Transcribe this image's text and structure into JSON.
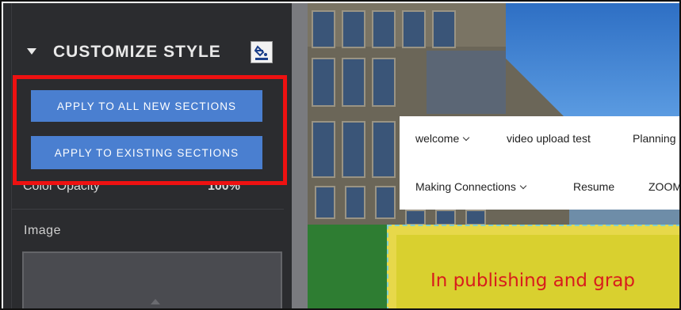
{
  "panel": {
    "header_title": "CUSTOMIZE STYLE",
    "caret_icon": "caret-down-icon",
    "paint_icon": "paint-bucket-icon",
    "apply_all_label": "APPLY TO ALL NEW SECTIONS",
    "apply_existing_label": "APPLY TO EXISTING SECTIONS",
    "partial_row_label": "Color Opacity",
    "partial_row_value": "100%",
    "image_label": "Image"
  },
  "preview": {
    "nav_items": [
      {
        "label": "welcome",
        "has_dropdown": true
      },
      {
        "label": "video upload test",
        "has_dropdown": false
      },
      {
        "label": "Planning",
        "has_dropdown": false
      },
      {
        "label": "Making Connections",
        "has_dropdown": true
      },
      {
        "label": "Resume",
        "has_dropdown": false
      },
      {
        "label": "ZOOM",
        "has_dropdown": false
      }
    ],
    "content_text": "In publishing and grap"
  },
  "colors": {
    "panel_bg": "#2b2c2f",
    "button_blue": "#4a7fd0",
    "highlight_red": "#ee1111",
    "green": "#2e7d32",
    "yellow": "#d9d02f",
    "text_red": "#d81c1c"
  }
}
